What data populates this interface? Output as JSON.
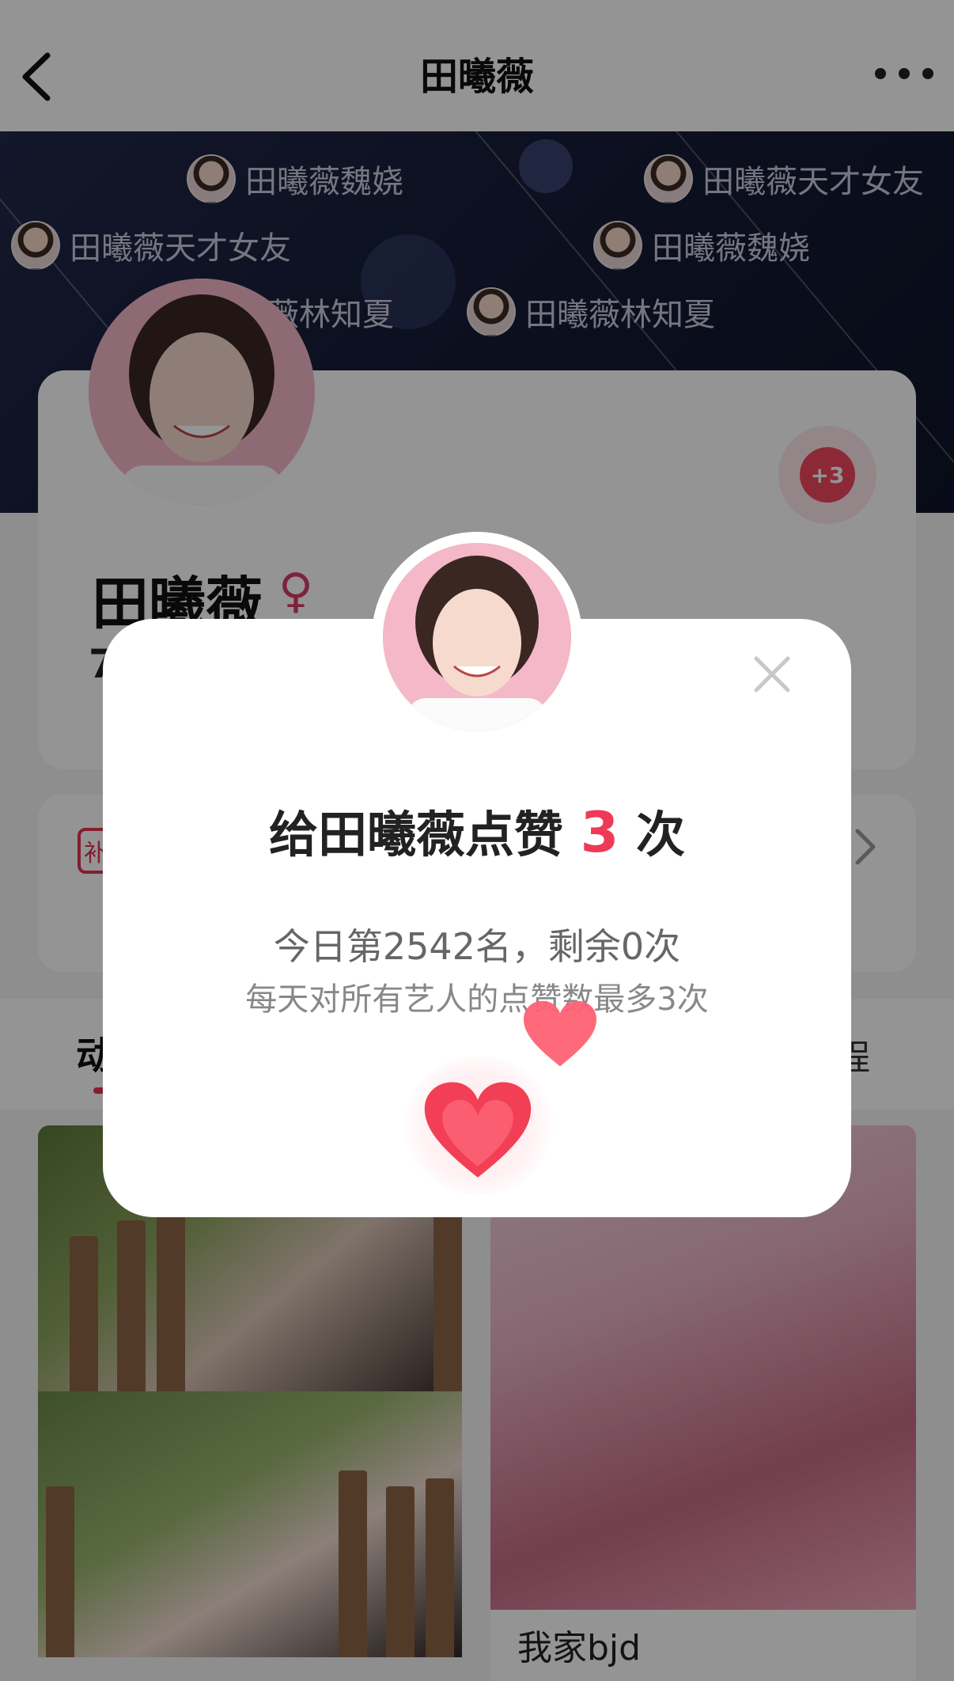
{
  "header": {
    "title": "田曦薇"
  },
  "banner": {
    "chips": [
      "田曦薇魏娆",
      "田曦薇天才女友",
      "田曦薇天才女友",
      "田曦薇魏娆",
      "薇林知夏",
      "田曦薇林知夏"
    ]
  },
  "profile": {
    "name": "田曦薇",
    "gender_symbol": "♀",
    "heart_badge": "+3",
    "stat_partial": "7"
  },
  "info_card": {
    "tag_partial": "补"
  },
  "tabs": {
    "left": "动",
    "right": "程"
  },
  "feed": {
    "caption": "我家bjd"
  },
  "modal": {
    "title_prefix": "给田曦薇点赞",
    "count": "3",
    "title_suffix": "次",
    "rank_line": "今日第2542名，剩余0次",
    "note_line": "每天对所有艺人的点赞数最多3次"
  },
  "colors": {
    "accent": "#ee3a57",
    "banner": "#1a2040"
  }
}
